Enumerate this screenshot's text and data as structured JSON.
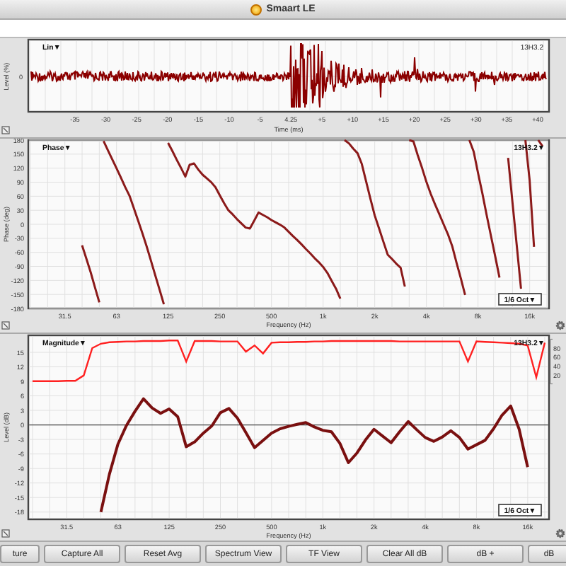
{
  "window": {
    "title": "Smaart LE"
  },
  "time_panel": {
    "trace_menu": "Lin▼",
    "measurement": "13H3.2",
    "ylabel": "Level (%)",
    "y_ticks": [
      "0"
    ],
    "xlabel": "Time (ms)",
    "x_ticks": [
      "-35",
      "-30",
      "-25",
      "-20",
      "-15",
      "-10",
      "-5",
      "4.25",
      "+5",
      "+10",
      "+15",
      "+20",
      "+25",
      "+30",
      "+35",
      "+40"
    ]
  },
  "phase_panel": {
    "trace_menu": "Phase▼",
    "measurement": "13H3.2▼",
    "smoothing": "1/6 Oct▼",
    "chart_data": {
      "type": "line",
      "xlabel": "Frequency (Hz)",
      "ylabel": "Phase (deg)",
      "categories": [
        null,
        null,
        null,
        null,
        null,
        null,
        null,
        null,
        "31.5",
        null,
        null,
        null,
        null,
        null,
        null,
        null,
        null,
        null,
        null,
        null,
        "63",
        null,
        null,
        null,
        null,
        null,
        null,
        null,
        null,
        null,
        null,
        null,
        "125",
        null,
        null,
        null,
        null,
        null,
        null,
        null,
        null,
        null,
        null,
        null,
        "250",
        null,
        null,
        null,
        null,
        null,
        null,
        null,
        null,
        null,
        null,
        null,
        "500",
        null,
        null,
        null,
        null,
        null,
        null,
        null,
        null,
        null,
        null,
        null,
        "1k",
        null,
        null,
        null,
        null,
        null,
        null,
        null,
        null,
        null,
        null,
        null,
        "2k",
        null,
        null,
        null,
        null,
        null,
        null,
        null,
        null,
        null,
        null,
        null,
        "4k",
        null,
        null,
        null,
        null,
        null,
        null,
        null,
        null,
        null,
        null,
        null,
        "8k",
        null,
        null,
        null,
        null,
        null,
        null,
        null,
        null,
        null,
        null,
        null,
        "16k",
        null,
        null,
        null,
        null
      ],
      "series": [
        {
          "color": "#8b1a1a",
          "values": [
            null,
            null,
            null,
            null,
            null,
            null,
            null,
            null,
            null,
            null,
            null,
            null,
            -45,
            -74,
            -103,
            -135,
            -167,
            178,
            158,
            139,
            120,
            100,
            80,
            61,
            35,
            8,
            -19,
            -47,
            -78,
            -109,
            -140,
            -171,
            174,
            156,
            138,
            120,
            102,
            127,
            130,
            117,
            106,
            98,
            90,
            79,
            62,
            45,
            30,
            21,
            11,
            2,
            -7,
            -9,
            8,
            25,
            20,
            15,
            9,
            4,
            -1,
            -7,
            -16,
            -25,
            -34,
            -43,
            -53,
            -62,
            -72,
            -81,
            -91,
            -104,
            -121,
            -138,
            -159,
            180,
            173,
            162,
            152,
            129,
            92,
            54,
            19,
            -9,
            -37,
            -65,
            -74,
            -84,
            -93,
            -133,
            180,
            177,
            148,
            120,
            91,
            65,
            43,
            22,
            0,
            -21,
            -47,
            -82,
            -116,
            -151,
            180,
            155,
            110,
            66,
            20,
            -24,
            -69,
            -114,
            null,
            142,
            49,
            -45,
            -138,
            180,
            94,
            -48,
            180,
            167,
            null
          ]
        }
      ],
      "ylim": [
        -180,
        180
      ],
      "grid": true,
      "yticks": [
        180,
        150,
        120,
        90,
        60,
        30,
        0,
        -30,
        -60,
        -90,
        -120,
        -150,
        -180
      ]
    }
  },
  "magnitude_panel": {
    "trace_menu": "Magnitude▼",
    "measurement": "13H3.2▼",
    "smoothing": "1/6 Oct▼",
    "chart_data": {
      "type": "line",
      "xlabel": "Frequency (Hz)",
      "ylabel": "Level (dB)",
      "categories": [
        null,
        null,
        null,
        null,
        "31.5",
        null,
        null,
        null,
        null,
        null,
        "63",
        null,
        null,
        null,
        null,
        null,
        "125",
        null,
        null,
        null,
        null,
        null,
        "250",
        null,
        null,
        null,
        null,
        null,
        "500",
        null,
        null,
        null,
        null,
        null,
        "1k",
        null,
        null,
        null,
        null,
        null,
        "2k",
        null,
        null,
        null,
        null,
        null,
        "4k",
        null,
        null,
        null,
        null,
        null,
        "8k",
        null,
        null,
        null,
        null,
        null,
        "16k",
        null,
        null
      ],
      "series": [
        {
          "color": "#7a1010",
          "values": [
            null,
            null,
            null,
            null,
            null,
            null,
            null,
            null,
            -18,
            -10.2,
            -4,
            -0.1,
            2.8,
            5.4,
            3.5,
            2.4,
            3.3,
            1.7,
            -4.5,
            -3.5,
            -1.7,
            -0.2,
            2.5,
            3.4,
            1.4,
            -1.6,
            -4.7,
            -3.2,
            -1.7,
            -0.8,
            -0.3,
            0.1,
            0.5,
            -0.4,
            -1.1,
            -1.4,
            -3.8,
            -7.8,
            -5.8,
            -3.1,
            -0.9,
            -2.3,
            -3.7,
            -1.4,
            0.7,
            -1,
            -2.6,
            -3.4,
            -2.5,
            -1.2,
            -2.6,
            -5,
            -4.1,
            -3.2,
            -0.8,
            2,
            3.9,
            -0.9,
            -8.7,
            null,
            null
          ]
        }
      ],
      "ylim": [
        -19.5,
        18.5
      ],
      "grid": true,
      "yticks": [
        15,
        12,
        9,
        6,
        3,
        0,
        -3,
        -6,
        -9,
        -12,
        -15,
        -18
      ]
    },
    "coherence": {
      "chart_data": {
        "type": "line",
        "categories": [
          null,
          null,
          null,
          null,
          null,
          null,
          null,
          null,
          null,
          null,
          null,
          null,
          null,
          null,
          null,
          null,
          null,
          null,
          null,
          null,
          null,
          null,
          null,
          null,
          null,
          null,
          null,
          null,
          null,
          null,
          null,
          null,
          null,
          null,
          null,
          null,
          null,
          null,
          null,
          null,
          null,
          null,
          null,
          null,
          null,
          null,
          null,
          null,
          null,
          null,
          null,
          null,
          null,
          null,
          null,
          null,
          null,
          null,
          null,
          null,
          null
        ],
        "series": [
          {
            "color": "#ff2020",
            "values": [
              6,
              6,
              6,
              6,
              7,
              7,
              19,
              80,
              90,
              93,
              94,
              95,
              95,
              96,
              96,
              96,
              97,
              97,
              50,
              96,
              96,
              96,
              95,
              95,
              95,
              72,
              86,
              68,
              92,
              93,
              93,
              94,
              94,
              95,
              95,
              96,
              96,
              96,
              96,
              96,
              96,
              96,
              96,
              95,
              95,
              95,
              95,
              95,
              95,
              95,
              95,
              50,
              95,
              94,
              93,
              92,
              91,
              90,
              86,
              15,
              92
            ]
          }
        ],
        "ylim": [
          0,
          100
        ],
        "yticks": [
          80,
          60,
          40,
          20
        ]
      }
    }
  },
  "buttons": [
    {
      "label": "ture"
    },
    {
      "label": "Capture All"
    },
    {
      "label": "Reset Avg"
    },
    {
      "label": "Spectrum View"
    },
    {
      "label": "TF View"
    },
    {
      "label": "Clear All dB"
    },
    {
      "label": "dB +"
    },
    {
      "label": "dB"
    }
  ]
}
